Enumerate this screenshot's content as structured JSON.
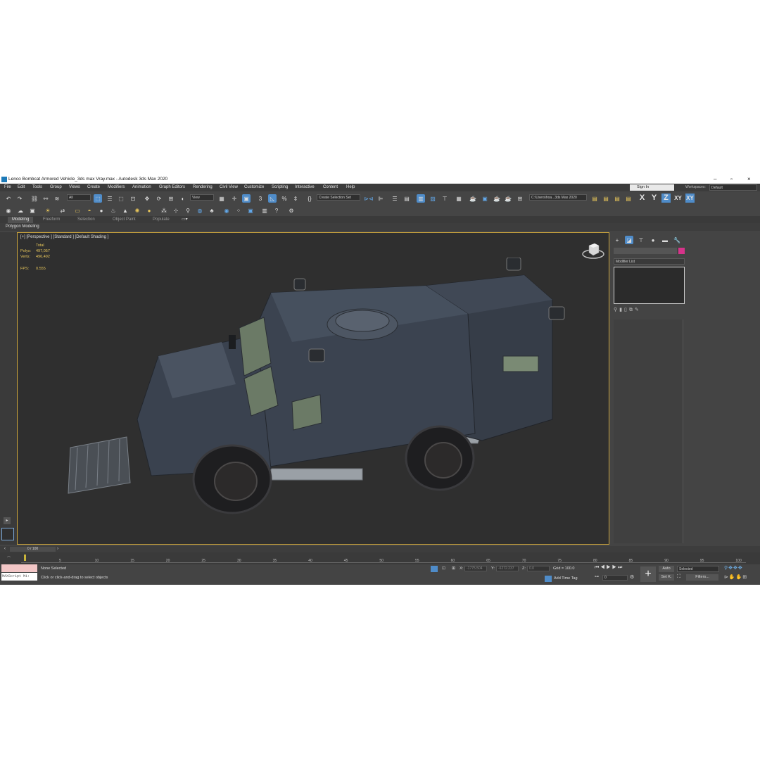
{
  "window": {
    "title": "Lenco Bombcat Armored Vehicle_3ds max Vray.max - Autodesk 3ds Max 2020"
  },
  "menu": [
    "File",
    "Edit",
    "Tools",
    "Group",
    "Views",
    "Create",
    "Modifiers",
    "Animation",
    "Graph Editors",
    "Rendering",
    "Civil View",
    "Customize",
    "Scripting",
    "Interactive",
    "Content",
    "Help"
  ],
  "account": {
    "sign_in": "Sign In",
    "workspaces_label": "Workspaces:",
    "workspace_value": "Default"
  },
  "toolbar": {
    "filter_value": "All",
    "refcoord_value": "View",
    "selection_set_placeholder": "Create Selection Set",
    "path_value": "C:\\Users\\hoa...3ds Max 2020",
    "axis_x": "X",
    "axis_y": "Y",
    "axis_z": "Z",
    "axis_xy": "XY",
    "axis_xyz": "XY"
  },
  "ribbon": {
    "tabs": [
      "Modeling",
      "Freeform",
      "Selection",
      "Object Paint",
      "Populate"
    ],
    "active_tab": "Modeling",
    "panel_label": "Polygon Modeling"
  },
  "viewport": {
    "label": "[+] [Perspective ] [Standard ] [Default Shading ]",
    "stats_header": "Total",
    "polys_label": "Polys:",
    "polys_value": "497,057",
    "verts_label": "Verts:",
    "verts_value": "496,492",
    "fps_label": "FPS:",
    "fps_value": "0.555"
  },
  "command_panel": {
    "modifier_list": "Modifier List",
    "accent_color": "#d6338a"
  },
  "timeline": {
    "frame_display": "0 / 100",
    "ticks": [
      "5",
      "10",
      "15",
      "20",
      "25",
      "30",
      "35",
      "40",
      "45",
      "50",
      "55",
      "60",
      "65",
      "70",
      "75",
      "80",
      "85",
      "90",
      "95",
      "100"
    ]
  },
  "status": {
    "maxscript_label": "MAXScript Mi:",
    "selection": "None Selected",
    "prompt": "Click or click-and-drag to select objects",
    "x_label": "X:",
    "x_value": "-1775.504",
    "y_label": "Y:",
    "y_value": "-6272.237",
    "z_label": "Z:",
    "z_value": "0.0",
    "grid": "Grid = 100.0",
    "add_time_tag": "Add Time Tag",
    "auto": "Auto",
    "set_k": "Set K.",
    "selected": "Selected",
    "filters": "Filters...",
    "frame_value": "0"
  },
  "icons": {
    "undo": "undo-icon",
    "redo": "redo-icon",
    "link": "link-icon",
    "unlink": "unlink-icon",
    "select": "select-icon",
    "move": "move-icon",
    "rotate": "rotate-icon",
    "scale": "scale-icon",
    "snap": "snap-icon",
    "render": "render-teapot-icon",
    "nav_cube": "viewcube-icon"
  }
}
